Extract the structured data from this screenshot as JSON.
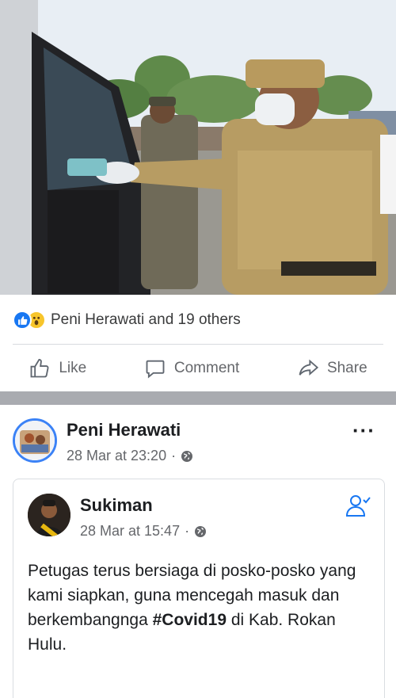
{
  "photo": {
    "description_icon": "photo-image"
  },
  "reactions": {
    "icons": [
      "like-reaction-icon",
      "wow-reaction-icon"
    ],
    "text": "Peni Herawati and 19 others"
  },
  "actions": {
    "like_label": "Like",
    "comment_label": "Comment",
    "share_label": "Share"
  },
  "post": {
    "author": "Peni Herawati",
    "timestamp": "28 Mar at 23:20",
    "dot": "·",
    "privacy_icon": "globe-icon",
    "more_label": "···"
  },
  "shared": {
    "author": "Sukiman",
    "timestamp": "28 Mar at 15:47",
    "dot": "·",
    "privacy_icon": "globe-icon",
    "text_before": "Petugas terus bersiaga di posko-posko yang kami siapkan, guna mencegah masuk dan berkembangnga ",
    "hashtag": "#Covid19",
    "text_after": " di Kab. Rokan Hulu."
  },
  "colors": {
    "accent": "#1877f2",
    "muted": "#65676b",
    "divider": "#a9abb0"
  }
}
